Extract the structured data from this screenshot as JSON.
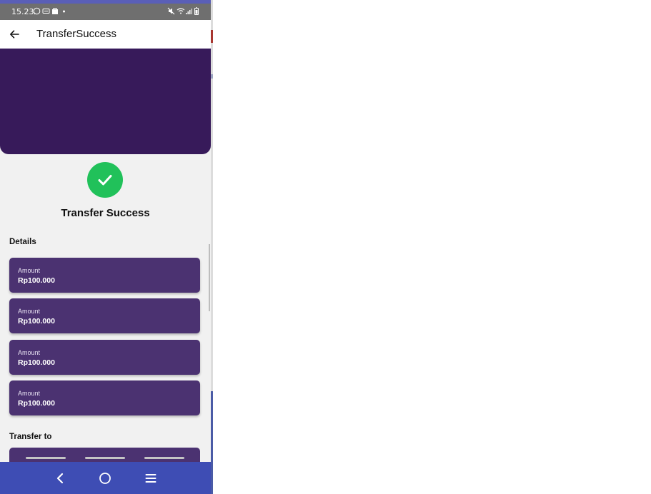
{
  "status_bar": {
    "time": "15.23",
    "icons": [
      "whatsapp-icon",
      "message-icon",
      "bag-icon",
      "dot-icon",
      "mute-icon",
      "wifi-icon",
      "signal-icon",
      "battery-icon"
    ]
  },
  "app_bar": {
    "title": "TransferSuccess",
    "back_icon": "arrow-left-icon"
  },
  "colors": {
    "header_purple": "#371a5a",
    "card_purple": "#4b3271",
    "success_green": "#21c15a",
    "nav_blue": "#3e4db4",
    "accent_top": "#5a5fb7"
  },
  "success": {
    "icon": "check-icon",
    "title": "Transfer Success"
  },
  "details": {
    "label": "Details",
    "cards": [
      {
        "label": "Amount",
        "value": "Rp100.000"
      },
      {
        "label": "Amount",
        "value": "Rp100.000"
      },
      {
        "label": "Amount",
        "value": "Rp100.000"
      },
      {
        "label": "Amount",
        "value": "Rp100.000"
      }
    ]
  },
  "transfer_to": {
    "label": "Transfer to"
  },
  "nav_bar": {
    "buttons": [
      "back-chevron-icon",
      "home-circle-icon",
      "recents-menu-icon"
    ]
  }
}
